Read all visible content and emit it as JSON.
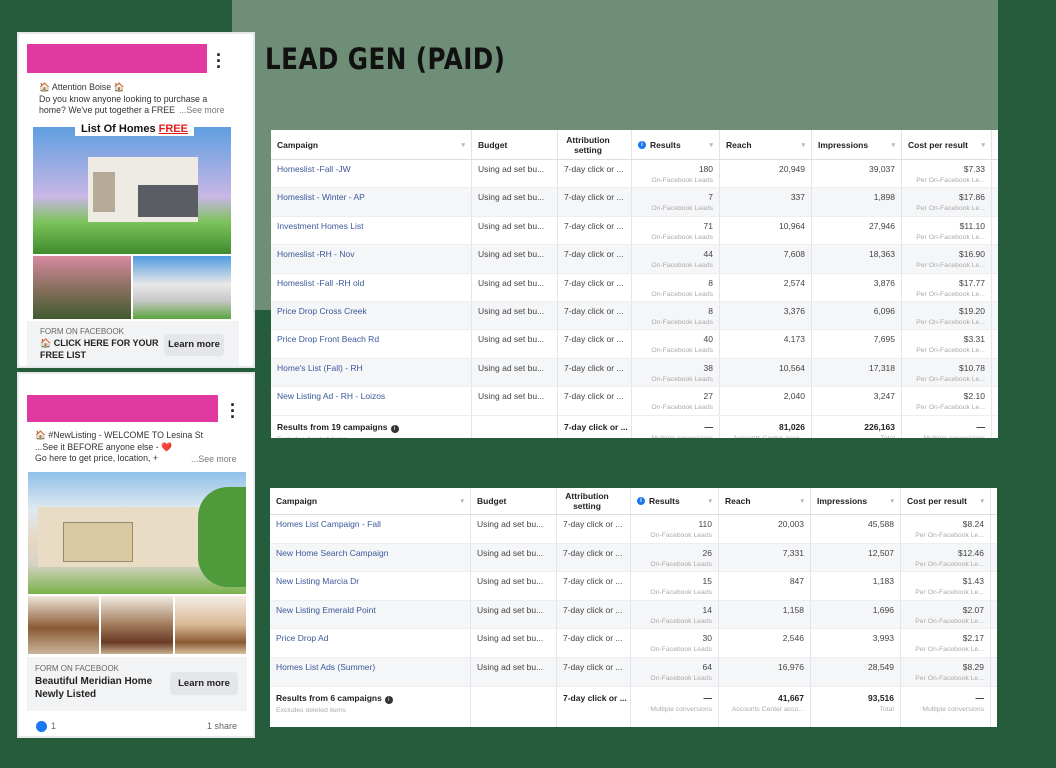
{
  "page": {
    "title": "LEAD GEN (PAID)"
  },
  "colors": {
    "background": "#245c3c",
    "overlay": "#6f8e77",
    "redaction": "#e03aa0",
    "link": "#3b5998"
  },
  "ad1": {
    "line1": "🏠 Attention Boise 🏠",
    "line2": "Do you know anyone looking to purchase a",
    "line3": "home? We've put together a FREE",
    "see_more": "...See more",
    "banner_text": "List Of Homes",
    "banner_highlight": "FREE",
    "form_label": "FORM ON FACEBOOK",
    "cta_text": "🏠 CLICK HERE FOR YOUR FREE LIST",
    "learn_more": "Learn more",
    "menu_icon": "more-vertical-icon"
  },
  "ad2": {
    "line1": "🏠 #NewListing - WELCOME TO Lesina St",
    "line2": "...See it BEFORE anyone else - ❤️",
    "line3": "Go here to get price, location, +",
    "see_more": "...See more",
    "form_label": "FORM ON FACEBOOK",
    "cta_text": "Beautiful Meridian Home Newly Listed",
    "learn_more": "Learn more",
    "likes": "1",
    "shares": "1 share",
    "menu_icon": "more-vertical-icon"
  },
  "columns": [
    "Campaign",
    "Budget",
    "Attribution setting",
    "Results",
    "Reach",
    "Impressions",
    "Cost per result"
  ],
  "table1": {
    "rows": [
      [
        "Homeslist -Fall -JW",
        "Using ad set bu...",
        "7-day click or ...",
        "180",
        "20,949",
        "39,037",
        "$7.33"
      ],
      [
        "Homeslist - Winter - AP",
        "Using ad set bu...",
        "7-day click or ...",
        "7",
        "337",
        "1,898",
        "$17.86"
      ],
      [
        "Investment Homes List",
        "Using ad set bu...",
        "7-day click or ...",
        "71",
        "10,964",
        "27,946",
        "$11.10"
      ],
      [
        "Homeslist -RH - Nov",
        "Using ad set bu...",
        "7-day click or ...",
        "44",
        "7,608",
        "18,363",
        "$16.90"
      ],
      [
        "Homeslist -Fall -RH old",
        "Using ad set bu...",
        "7-day click or ...",
        "8",
        "2,574",
        "3,876",
        "$17.77"
      ],
      [
        "Price Drop Cross Creek",
        "Using ad set bu...",
        "7-day click or ...",
        "8",
        "3,376",
        "6,096",
        "$19.20"
      ],
      [
        "Price Drop Front Beach Rd",
        "Using ad set bu...",
        "7-day click or ...",
        "40",
        "4,173",
        "7,695",
        "$3.31"
      ],
      [
        "Home's List (Fall) - RH",
        "Using ad set bu...",
        "7-day click or ...",
        "38",
        "10,564",
        "17,318",
        "$10.78"
      ],
      [
        "New Listing Ad - RH - Loizos",
        "Using ad set bu...",
        "7-day click or ...",
        "27",
        "2,040",
        "3,247",
        "$2.10"
      ]
    ],
    "result_sub": "On-Facebook Leads",
    "cost_sub": "Per On-Facebook Le...",
    "total": [
      "Results from 19 campaigns",
      "",
      "7-day click or ...",
      "—",
      "81,026",
      "226,163",
      "—"
    ],
    "total_sub": [
      "Excludes deleted items",
      "",
      "",
      "Multiple conversions",
      "Accounts Center acco...",
      "Total",
      "Multiple conversions"
    ]
  },
  "table2": {
    "rows": [
      [
        "Homes List Campaign - Fall",
        "Using ad set bu...",
        "7-day click or ...",
        "110",
        "20,003",
        "45,588",
        "$8.24"
      ],
      [
        "New Home Search Campaign",
        "Using ad set bu...",
        "7-day click or ...",
        "26",
        "7,331",
        "12,507",
        "$12.46"
      ],
      [
        "New Listing Marcia Dr",
        "Using ad set bu...",
        "7-day click or ...",
        "15",
        "847",
        "1,183",
        "$1.43"
      ],
      [
        "New Listing Emerald Point",
        "Using ad set bu...",
        "7-day click or ...",
        "14",
        "1,158",
        "1,696",
        "$2.07"
      ],
      [
        "Price Drop Ad",
        "Using ad set bu...",
        "7-day click or ...",
        "30",
        "2,546",
        "3,993",
        "$2.17"
      ],
      [
        "Homes List Ads (Summer)",
        "Using ad set bu...",
        "7-day click or ...",
        "64",
        "16,976",
        "28,549",
        "$8.29"
      ]
    ],
    "result_sub": "On-Facebook Leads",
    "cost_sub": "Per On-Facebook Le...",
    "total": [
      "Results from 6 campaigns",
      "",
      "7-day click or ...",
      "—",
      "41,667",
      "93,516",
      "—"
    ],
    "total_sub": [
      "Excludes deleted items",
      "",
      "",
      "Multiple conversions",
      "Accounts Center acco...",
      "Total",
      "Multiple conversions"
    ]
  }
}
